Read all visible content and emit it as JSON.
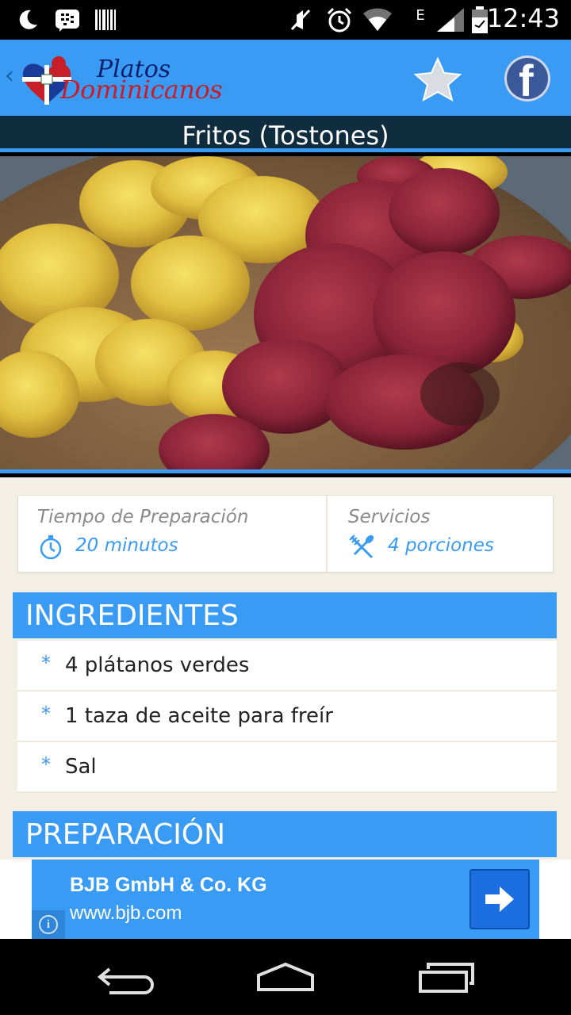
{
  "status_bar": {
    "time": "12:43",
    "icons": [
      "moon-icon",
      "bbm-icon",
      "barcode-icon",
      "mute-icon",
      "alarm-icon",
      "wifi-icon",
      "edge-signal-icon",
      "battery-icon"
    ],
    "network_label": "E"
  },
  "app_bar": {
    "logo_line1": "Platos",
    "logo_line2": "Dominicanos",
    "back_glyph": "‹",
    "facebook_glyph": "f"
  },
  "recipe": {
    "title": "Fritos (Tostones)",
    "prep_time_label": "Tiempo de Preparación",
    "prep_time_value": "20 minutos",
    "servings_label": "Servicios",
    "servings_value": "4 porciones"
  },
  "ingredients": {
    "header": "INGREDIENTES",
    "bullet": "*",
    "items": [
      "4 plátanos verdes",
      "1 taza de aceite para freír",
      "Sal"
    ]
  },
  "preparation": {
    "header": "PREPARACIÓN"
  },
  "ad": {
    "title": "BJB GmbH & Co. KG",
    "url": "www.bjb.com",
    "info_glyph": "i"
  },
  "colors": {
    "accent": "#3a9bf5",
    "title_band": "#0f2d3e",
    "background": "#f3efe4"
  }
}
